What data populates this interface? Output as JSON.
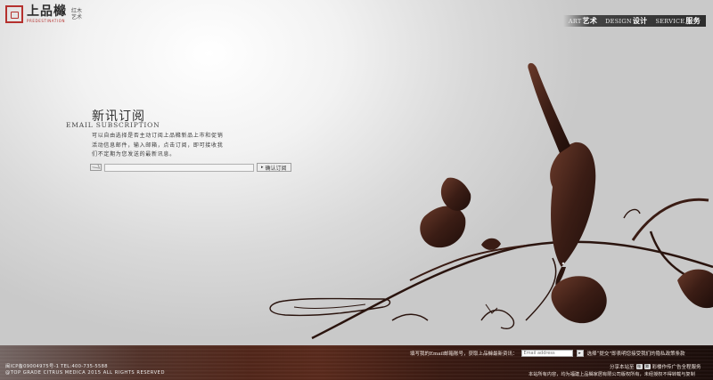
{
  "logo": {
    "name_cn": "上品櫞",
    "name_en": "PREDESTINATION",
    "tag_line1": "红木",
    "tag_line2": "艺术",
    "brand_color": "#b5312e"
  },
  "nav": {
    "items": [
      {
        "en": "ART",
        "cn": "艺术"
      },
      {
        "en": "DESIGN",
        "cn": "设计"
      },
      {
        "en": "SERVICE",
        "cn": "服务"
      }
    ]
  },
  "subscribe": {
    "title": "新讯订阅",
    "title_en": "EMAIL SUBSCRIPTION",
    "desc": "可以自由选择是否主动订阅上品櫞新品上市和促销活动信息邮件，输入邮箱，点击订阅，即可接收我们不定期为您发送的最新讯息。",
    "input_value": "",
    "button_label": "确认订阅",
    "mail_icon": "mail-icon"
  },
  "footer": {
    "icp": "闽ICP备09004975号-1  TEL:400-735-5588",
    "copyright": "@TOP GRADE CITRUS MEDICA  2015  ALL RIGHTS RESERVED",
    "newsletter_prompt": "填写我的Email邮箱账号，获取上品櫞最新资讯：",
    "newsletter_placeholder": "Email address",
    "newsletter_button": "▸",
    "newsletter_note": "选择“提交”即表明您接受我们的隐私政策条款",
    "share_label": "分享本站至",
    "share_icons": [
      "weibo-icon",
      "tencent-icon"
    ],
    "credit": "彩楼作传广告全程服务",
    "legal": "本站所有内容，均为福建上品櫞家居有限公司版权所有，未经授权不得转载与复制"
  }
}
